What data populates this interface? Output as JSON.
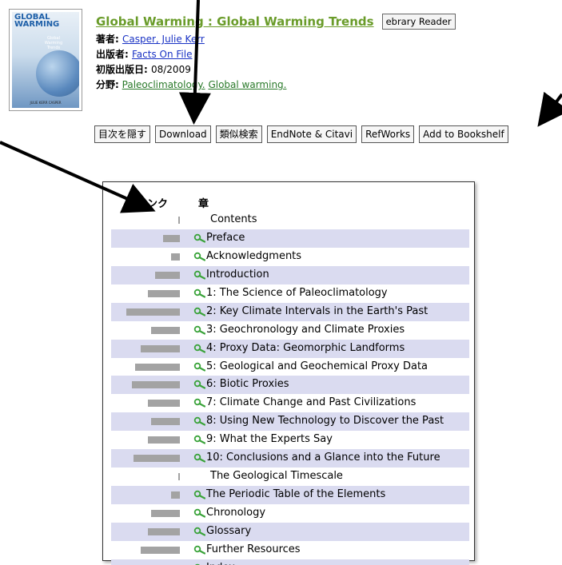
{
  "book": {
    "cover_title": "GLOBAL\nWARMING",
    "cover_subtitle": "Global\nWarming\nTrends",
    "cover_author": "JULIE KERR CASPER",
    "title": "Global Warming : Global Warming Trends",
    "reader_button": "ebrary Reader",
    "meta": [
      {
        "label": "著者:",
        "value": "Casper, Julie Kerr",
        "type": "link"
      },
      {
        "label": "出版者:",
        "value": "Facts On File",
        "type": "link"
      },
      {
        "label": "初版出版日:",
        "value": "08/2009",
        "type": "text"
      }
    ],
    "subject_label": "分野:",
    "subjects": [
      "Paleoclimatology.",
      "Global warming."
    ]
  },
  "toolbar": {
    "buttons": [
      "目次を隠す",
      "Download",
      "類似検索",
      "EndNote & Citavi",
      "RefWorks",
      "Add to Bookshelf"
    ]
  },
  "toc": {
    "header_rank": "ランク",
    "header_chapter": "章",
    "items": [
      {
        "label": "Contents",
        "rank": 0.03,
        "zoom": false
      },
      {
        "label": "Preface",
        "rank": 0.32,
        "zoom": true
      },
      {
        "label": "Acknowledgments",
        "rank": 0.17,
        "zoom": true
      },
      {
        "label": "Introduction",
        "rank": 0.47,
        "zoom": true
      },
      {
        "label": "1: The Science of Paleoclimatology",
        "rank": 0.6,
        "zoom": true
      },
      {
        "label": "2: Key Climate Intervals in the Earth's Past",
        "rank": 1.0,
        "zoom": true
      },
      {
        "label": "3: Geochronology and Climate Proxies",
        "rank": 0.53,
        "zoom": true
      },
      {
        "label": "4: Proxy Data: Geomorphic Landforms",
        "rank": 0.73,
        "zoom": true
      },
      {
        "label": "5: Geological and Geochemical Proxy Data",
        "rank": 0.83,
        "zoom": true
      },
      {
        "label": "6: Biotic Proxies",
        "rank": 0.9,
        "zoom": true
      },
      {
        "label": "7: Climate Change and Past Civilizations",
        "rank": 0.6,
        "zoom": true
      },
      {
        "label": "8: Using New Technology to Discover the Past",
        "rank": 0.53,
        "zoom": true
      },
      {
        "label": "9: What the Experts Say",
        "rank": 0.6,
        "zoom": true
      },
      {
        "label": "10: Conclusions and a Glance into the Future",
        "rank": 0.87,
        "zoom": true
      },
      {
        "label": "The Geological Timescale",
        "rank": 0.03,
        "zoom": false
      },
      {
        "label": "The Periodic Table of the Elements",
        "rank": 0.17,
        "zoom": true
      },
      {
        "label": "Chronology",
        "rank": 0.53,
        "zoom": true
      },
      {
        "label": "Glossary",
        "rank": 0.6,
        "zoom": true
      },
      {
        "label": "Further Resources",
        "rank": 0.73,
        "zoom": true
      },
      {
        "label": "Index",
        "rank": 0.53,
        "zoom": true
      }
    ]
  },
  "colors": {
    "title": "#6a9c2a",
    "link": "#1a33c4",
    "row_alt": "#dadbf0",
    "rank_bar": "#a3a3a3",
    "zoom_icon": "#3aa33a"
  }
}
